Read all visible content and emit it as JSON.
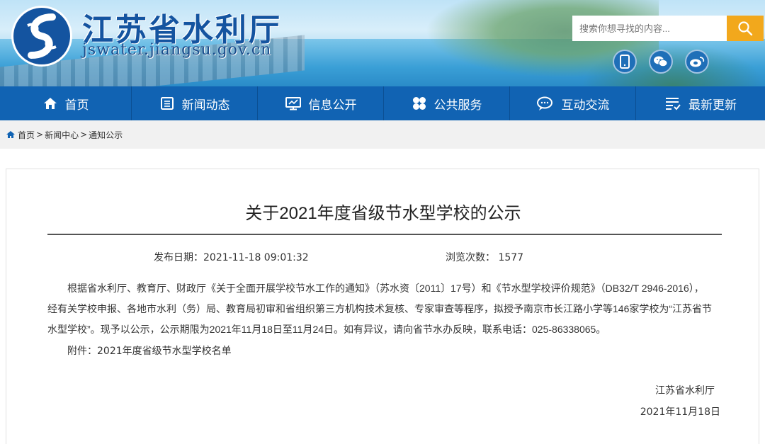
{
  "header": {
    "site_title": "江苏省水利厅",
    "site_url": "jswater.jiangsu.gov.cn",
    "search_placeholder": "搜索你想寻找的内容...",
    "social_icons": [
      "mobile-icon",
      "wechat-icon",
      "weibo-icon"
    ]
  },
  "nav": {
    "items": [
      {
        "label": "首页",
        "icon": "home-icon"
      },
      {
        "label": "新闻动态",
        "icon": "news-icon"
      },
      {
        "label": "信息公开",
        "icon": "info-icon"
      },
      {
        "label": "公共服务",
        "icon": "service-icon"
      },
      {
        "label": "互动交流",
        "icon": "chat-icon"
      },
      {
        "label": "最新更新",
        "icon": "update-icon"
      }
    ]
  },
  "breadcrumb": {
    "home": "首页",
    "sep": ">",
    "news_center": "新闻中心",
    "current": "通知公示"
  },
  "article": {
    "title": "关于2021年度省级节水型学校的公示",
    "date_label": "发布日期：",
    "date_value": "2021-11-18 09:01:32",
    "views_label": "浏览次数：",
    "views_value": "1577",
    "body": "根据省水利厅、教育厅、财政厅《关于全面开展学校节水工作的通知》（苏水资〔2011〕17号）和《节水型学校评价规范》（DB32/T 2946-2016），经有关学校申报、各地市水利（务）局、教育局初审和省组织第三方机构技术复核、专家审查等程序，拟授予南京市长江路小学等146家学校为“江苏省节水型学校”。现予以公示，公示期限为2021年11月18日至11月24日。如有异议，请向省节水办反映，联系电话：025-86338065。",
    "attachment": "附件：2021年度省级节水型学校名单",
    "sign_org": "江苏省水利厅",
    "sign_date": "2021年11月18日"
  },
  "colors": {
    "nav_bg": "#1163b3",
    "search_button": "#f2a81c",
    "title_blue": "#1454a0"
  }
}
